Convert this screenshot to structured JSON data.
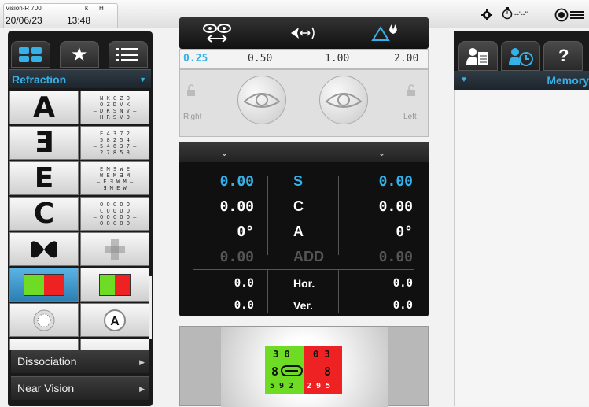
{
  "device": {
    "brand": "Vision-R 700",
    "k_label": "k",
    "h_label": "H",
    "date": "20/06/23",
    "time": "13:48",
    "timer_text": "--'--\""
  },
  "left": {
    "selector": "Refraction",
    "bottom_items": [
      "Dissociation",
      "Near Vision"
    ],
    "charts": [
      {
        "letter": "A",
        "mini": [
          "N K C Z O",
          "O Z D V K",
          "— D K S N V —",
          "H R S V D"
        ]
      },
      {
        "letter": "Ǝ",
        "mini": [
          "E 4 3 7 2",
          "5 8 2 5 4",
          "— 5 4 6 3 7 —",
          "2 7 8 5 3"
        ]
      },
      {
        "letter": "E",
        "mini": [
          "E M Ǝ W E",
          "W E M Ǝ M",
          "— E Ǝ W M —",
          "Ǝ M E W"
        ]
      },
      {
        "letter": "C",
        "mini": [
          "O O C O O",
          "C O O O O",
          "— O O C O O —",
          "O O C O O"
        ]
      }
    ]
  },
  "scale": {
    "values": [
      "0.25",
      "0.50",
      "1.00",
      "2.00"
    ],
    "selected": "0.25",
    "left_side": "Right",
    "right_side": "Left"
  },
  "values": {
    "rows": [
      {
        "l": "0.00",
        "m": "S",
        "r": "0.00",
        "color": "#36b0e8"
      },
      {
        "l": "0.00",
        "m": "C",
        "r": "0.00",
        "color": "#ffffff"
      },
      {
        "l": "0°",
        "m": "A",
        "r": "0°",
        "color": "#ffffff"
      },
      {
        "l": "0.00",
        "m": "ADD",
        "r": "0.00",
        "color": "#555555"
      },
      {
        "l": "0.0",
        "m": "Hor.",
        "r": "0.0",
        "color": "#ffffff"
      },
      {
        "l": "0.0",
        "m": "Ver.",
        "r": "0.0",
        "color": "#ffffff"
      }
    ]
  },
  "preview": {
    "g_top": "3 0",
    "r_top": "0 3",
    "g_mid": "8",
    "r_mid": "8",
    "g_bot": "5 9 2",
    "r_bot": "2 9 5"
  },
  "right": {
    "memory_label": "Memory",
    "tab_help": "?"
  },
  "colors": {
    "accent": "#36b0e8",
    "green": "#6edc24",
    "red": "#ee2222"
  }
}
